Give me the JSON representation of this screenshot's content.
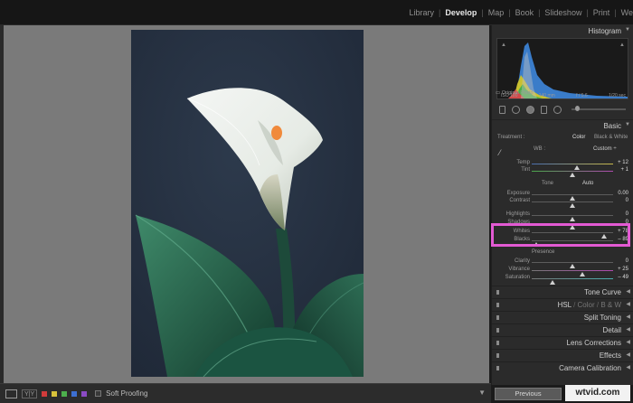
{
  "modules": [
    "Library",
    "Develop",
    "Map",
    "Book",
    "Slideshow",
    "Print",
    "We"
  ],
  "histogram": {
    "title": "Histogram",
    "iso": "ISO 100",
    "focal": "140 mm",
    "aperture": "f / 5.6",
    "shutter": "1/20 sec",
    "original_photo": "Original Photo"
  },
  "basic": {
    "title": "Basic",
    "treatment_label": "Treatment :",
    "color": "Color",
    "bw": "Black & White",
    "wb_label": "WB :",
    "wb_value": "Custom",
    "tone_label": "Tone",
    "auto_label": "Auto",
    "presence_label": "Presence"
  },
  "sliders": {
    "temp": {
      "label": "Temp",
      "value": "+ 12",
      "pos": 0.55
    },
    "tint": {
      "label": "Tint",
      "value": "+ 1",
      "pos": 0.5
    },
    "exposure": {
      "label": "Exposure",
      "value": "0.00",
      "pos": 0.5
    },
    "contrast": {
      "label": "Contrast",
      "value": "0",
      "pos": 0.5
    },
    "highlights": {
      "label": "Highlights",
      "value": "0",
      "pos": 0.5
    },
    "shadows": {
      "label": "Shadows",
      "value": "0",
      "pos": 0.5
    },
    "whites": {
      "label": "Whites",
      "value": "+ 78",
      "pos": 0.89
    },
    "blacks": {
      "label": "Blacks",
      "value": "– 89",
      "pos": 0.06
    },
    "clarity": {
      "label": "Clarity",
      "value": "0",
      "pos": 0.5
    },
    "vibrance": {
      "label": "Vibrance",
      "value": "+ 25",
      "pos": 0.62
    },
    "saturation": {
      "label": "Saturation",
      "value": "– 49",
      "pos": 0.26
    }
  },
  "panels": {
    "tone_curve": "Tone Curve",
    "hsl": "HSL",
    "color": "Color",
    "bw": "B & W",
    "split_toning": "Split Toning",
    "detail": "Detail",
    "lens_corrections": "Lens Corrections",
    "effects": "Effects",
    "camera_calibration": "Camera Calibration"
  },
  "toolbar": {
    "yy_label": "Y|Y",
    "soft_proofing": "Soft Proofing",
    "previous": "Previous",
    "watermark": "wtvid.com"
  },
  "colors": {
    "highlight": "#e35ad3"
  }
}
